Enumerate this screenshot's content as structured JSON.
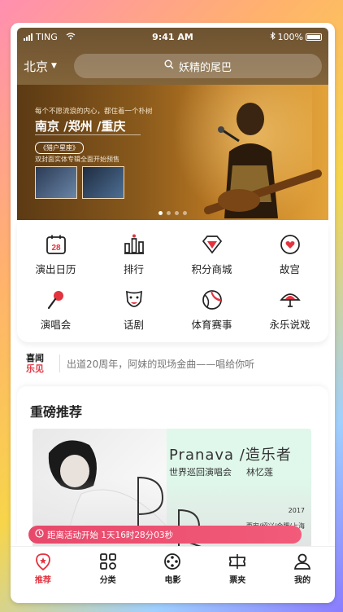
{
  "status_bar": {
    "carrier": "TING",
    "time": "9:41 AM",
    "battery": "100%"
  },
  "header": {
    "city": "北京",
    "search_placeholder": "妖精的尾巴"
  },
  "banner": {
    "subtitle": "每个不愿流浪的内心，都住着一个朴树",
    "cities": "南京 /郑州 /重庆",
    "tag": "《猎户星座》",
    "description": "双封面实体专辑全面开始预售"
  },
  "categories": [
    {
      "label": "演出日历",
      "icon": "calendar-icon",
      "badge": "28"
    },
    {
      "label": "排行",
      "icon": "ranking-icon"
    },
    {
      "label": "积分商城",
      "icon": "diamond-icon"
    },
    {
      "label": "故宫",
      "icon": "heart-icon"
    },
    {
      "label": "演唱会",
      "icon": "microphone-icon"
    },
    {
      "label": "话剧",
      "icon": "drama-mask-icon"
    },
    {
      "label": "体育赛事",
      "icon": "ball-icon"
    },
    {
      "label": "永乐说戏",
      "icon": "fan-icon"
    }
  ],
  "headline": {
    "logo_top": "喜闻",
    "logo_bottom": "乐见",
    "text": "出道20周年，阿妹的现场金曲——唱给你听"
  },
  "recommend": {
    "title": "重磅推荐",
    "name": "Pranava /造乐者",
    "subtitle": "世界巡回演唱会",
    "artist": "林忆莲",
    "year": "2017",
    "cities": "西安/绍兴/合肥/上海",
    "countdown": "距离活动开始 1天16时28分03秒"
  },
  "tabs": [
    {
      "label": "推荐",
      "icon": "home-star-icon",
      "active": true
    },
    {
      "label": "分类",
      "icon": "grid-icon"
    },
    {
      "label": "电影",
      "icon": "film-reel-icon"
    },
    {
      "label": "票夹",
      "icon": "ticket-icon"
    },
    {
      "label": "我的",
      "icon": "user-icon"
    }
  ],
  "colors": {
    "accent": "#e2333f",
    "banner_warm": "#c27d23",
    "countdown": "#e8496b"
  }
}
